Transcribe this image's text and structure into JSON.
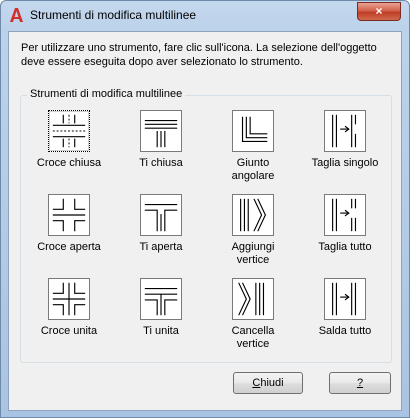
{
  "window": {
    "title": "Strumenti di modifica multilinee",
    "close_symbol": "×"
  },
  "instructions": "Per utilizzare uno strumento, fare clic sull'icona. La selezione dell'oggetto deve essere eseguita dopo aver selezionato lo strumento.",
  "group": {
    "label": "Strumenti di modifica multilinee",
    "tools": [
      {
        "label": "Croce chiusa",
        "icon": "closed-cross-icon"
      },
      {
        "label": "Ti chiusa",
        "icon": "closed-tee-icon"
      },
      {
        "label": "Giunto\nangolare",
        "icon": "corner-joint-icon"
      },
      {
        "label": "Taglia singolo",
        "icon": "cut-single-icon"
      },
      {
        "label": "Croce aperta",
        "icon": "open-cross-icon"
      },
      {
        "label": "Ti aperta",
        "icon": "open-tee-icon"
      },
      {
        "label": "Aggiungi\nvertice",
        "icon": "add-vertex-icon"
      },
      {
        "label": "Taglia tutto",
        "icon": "cut-all-icon"
      },
      {
        "label": "Croce unita",
        "icon": "merged-cross-icon"
      },
      {
        "label": "Ti unita",
        "icon": "merged-tee-icon"
      },
      {
        "label": "Cancella\nvertice",
        "icon": "delete-vertex-icon"
      },
      {
        "label": "Salda tutto",
        "icon": "weld-all-icon"
      }
    ]
  },
  "buttons": {
    "close": {
      "mnemonic": "C",
      "rest": "hiudi"
    },
    "help": {
      "label": "?"
    }
  },
  "colors": {
    "titlebar": "#bcd2ea",
    "client_bg": "#f0f0f0",
    "close_button": "#c84a32",
    "app_icon": "#d32f2f"
  }
}
